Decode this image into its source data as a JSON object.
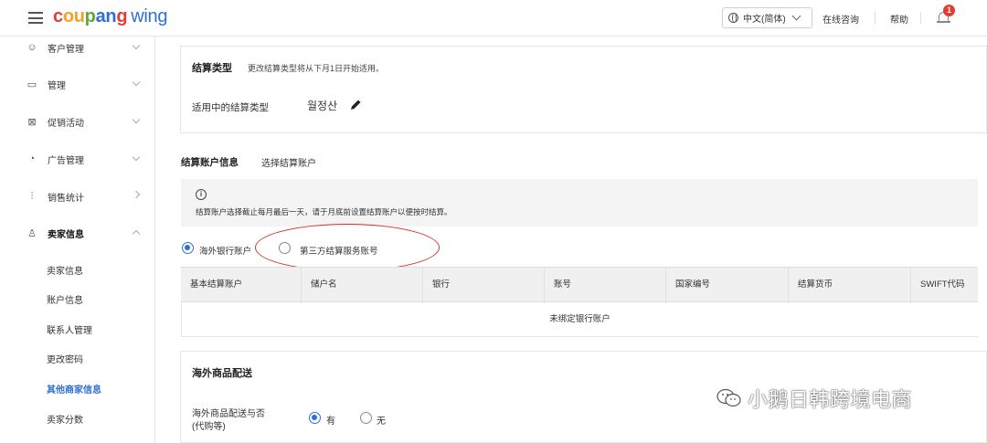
{
  "header": {
    "logo": {
      "c": "c",
      "o1": "o",
      "u": "u",
      "p": "p",
      "a": "a",
      "n": "n",
      "g": "g",
      "wing": "wing"
    },
    "language": "中文(简体)",
    "links": [
      "在线咨询",
      "帮助"
    ],
    "notification_count": "1"
  },
  "sidebar": {
    "items": [
      {
        "label": "客户管理",
        "icon": "smile-icon"
      },
      {
        "label": "管理",
        "icon": "card-icon"
      },
      {
        "label": "促销活动",
        "icon": "percent-icon"
      },
      {
        "label": "广告管理",
        "icon": "pie-icon"
      },
      {
        "label": "销售统计",
        "icon": "bar-chart-icon"
      },
      {
        "label": "卖家信息",
        "icon": "user-icon"
      }
    ],
    "sub_items": [
      "卖家信息",
      "账户信息",
      "联系人管理",
      "更改密码",
      "其他商家信息",
      "卖家分数"
    ]
  },
  "settlement_type": {
    "title": "结算类型",
    "note": "更改结算类型将从下月1日开始适用。",
    "current_label": "适用中的结算类型",
    "current_value": "월정산"
  },
  "settlement_account": {
    "title": "结算账户信息",
    "subtitle": "选择结算账户",
    "info_text": "结算账户选择截止每月最后一天，请于月底前设置结算账户以便按时结算。",
    "options": [
      "海外银行账户",
      "第三方结算服务账号"
    ],
    "table": {
      "headers": [
        "基本结算账户",
        "储户名",
        "银行",
        "账号",
        "国家编号",
        "结算货币",
        "SWIFT代码"
      ],
      "empty_text": "未绑定银行账户"
    }
  },
  "overseas_delivery": {
    "title": "海外商品配送",
    "question_line1": "海外商品配送与否",
    "question_line2": "(代购等)",
    "options": [
      "有",
      "无"
    ]
  },
  "watermark": "小鹅日韩跨境电商",
  "colors": {
    "accent": "#2f6fd2",
    "annotation": "#d9342b"
  }
}
